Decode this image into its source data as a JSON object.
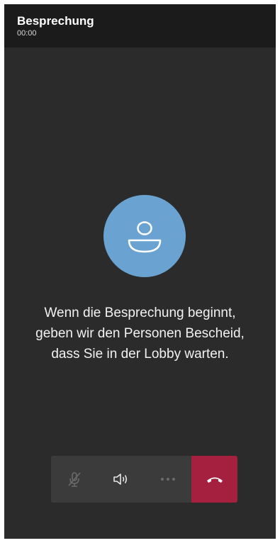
{
  "header": {
    "title": "Besprechung",
    "time": "00:00"
  },
  "lobby": {
    "line1": "Wenn die Besprechung beginnt,",
    "line2": "geben wir den Personen Bescheid,",
    "line3": "dass Sie in der Lobby warten."
  },
  "controls": [
    {
      "name": "mute-microphone",
      "icon": "microphone-off-icon"
    },
    {
      "name": "speaker",
      "icon": "speaker-icon"
    },
    {
      "name": "more-options",
      "icon": "more-horizontal-icon"
    },
    {
      "name": "hang-up",
      "icon": "phone-hangup-icon"
    }
  ],
  "colors": {
    "background": "#2b2b2b",
    "header": "#1b1b1b",
    "avatar": "#6aa3d1",
    "control_bar": "#3b3b3b",
    "hangup": "#a5203f"
  }
}
